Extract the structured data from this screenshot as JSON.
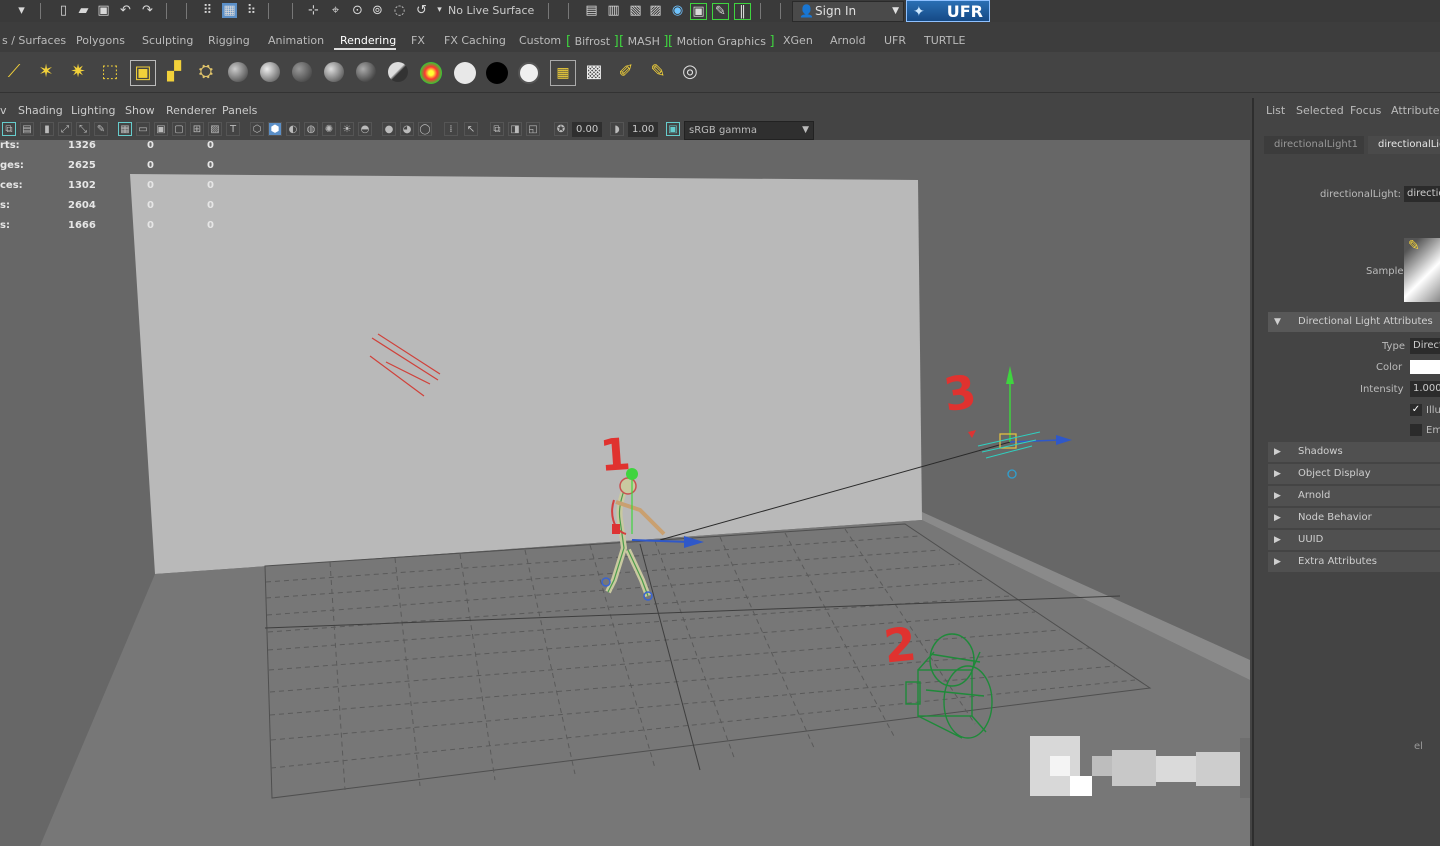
{
  "statusline": {
    "live_surface": "No Live Surface",
    "sign_in": "Sign In",
    "plugin_badge": "UFR"
  },
  "shelf_tabs": [
    "s / Surfaces",
    "Polygons",
    "Sculpting",
    "Rigging",
    "Animation",
    "Rendering",
    "FX",
    "FX Caching",
    "Custom",
    "Bifrost",
    "MASH",
    "Motion Graphics",
    "XGen",
    "Arnold",
    "UFR",
    "TURTLE"
  ],
  "active_shelf_tab": "Rendering",
  "viewport": {
    "menu": [
      "v",
      "Shading",
      "Lighting",
      "Show",
      "Renderer",
      "Panels"
    ],
    "exposure": "0.00",
    "gamma": "1.00",
    "color_space": "sRGB gamma",
    "hud": [
      {
        "label": "rts:",
        "v1": "1326",
        "v2": "0",
        "v3": "0"
      },
      {
        "label": "ges:",
        "v1": "2625",
        "v2": "0",
        "v3": "0"
      },
      {
        "label": "ces:",
        "v1": "1302",
        "v2": "0",
        "v3": "0"
      },
      {
        "label": "s:",
        "v1": "2604",
        "v2": "0",
        "v3": "0"
      },
      {
        "label": "s:",
        "v1": "1666",
        "v2": "0",
        "v3": "0"
      }
    ],
    "annotations": [
      "1",
      "2",
      "3"
    ],
    "corner_label": "el"
  },
  "attribute_editor": {
    "tabs": [
      "List",
      "Selected",
      "Focus",
      "Attributes"
    ],
    "node_tabs": [
      "directionalLight1",
      "directionalLig"
    ],
    "node_label": "directionalLight:",
    "node_value": "directio",
    "sample_label": "Sample",
    "section_open": "Directional Light Attributes",
    "type_label": "Type",
    "type_value": "Direct",
    "color_label": "Color",
    "intensity_label": "Intensity",
    "intensity_value": "1.000",
    "check1": "Illu",
    "check2": "Emi",
    "sections_closed": [
      "Shadows",
      "Object Display",
      "Arnold",
      "Node Behavior",
      "UUID",
      "Extra Attributes"
    ]
  }
}
